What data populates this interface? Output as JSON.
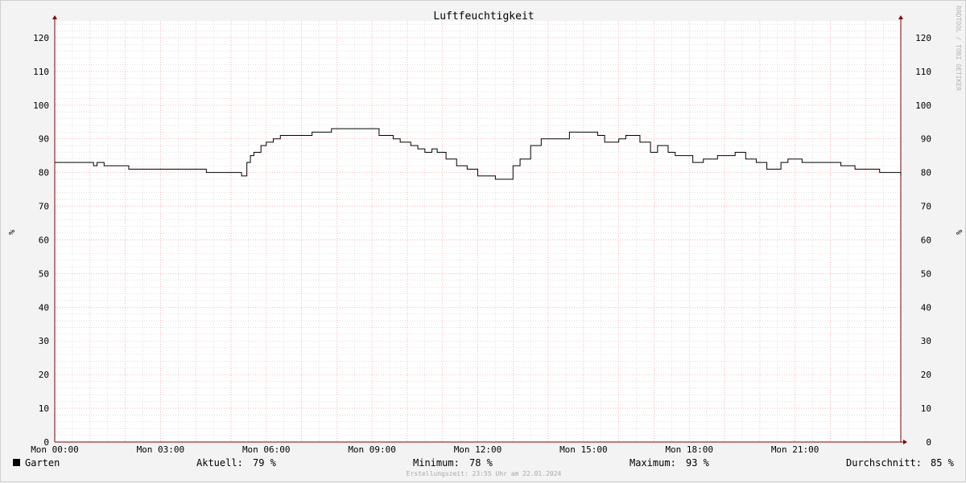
{
  "chart_data": {
    "type": "line",
    "title": "Luftfeuchtigkeit",
    "ylabel": "%",
    "ylim": [
      0,
      125
    ],
    "yticks": [
      0,
      10,
      20,
      30,
      40,
      50,
      60,
      70,
      80,
      90,
      100,
      110,
      120
    ],
    "xlim": [
      0,
      24
    ],
    "xticks": [
      {
        "value": 0,
        "label": "Mon 00:00"
      },
      {
        "value": 3,
        "label": "Mon 03:00"
      },
      {
        "value": 6,
        "label": "Mon 06:00"
      },
      {
        "value": 9,
        "label": "Mon 09:00"
      },
      {
        "value": 12,
        "label": "Mon 12:00"
      },
      {
        "value": 15,
        "label": "Mon 15:00"
      },
      {
        "value": 18,
        "label": "Mon 18:00"
      },
      {
        "value": 21,
        "label": "Mon 21:00"
      }
    ],
    "grid": true,
    "series": [
      {
        "name": "Garten",
        "color": "#000000",
        "x": [
          0,
          1.1,
          1.2,
          1.4,
          2.1,
          3.2,
          4.3,
          5.3,
          5.45,
          5.55,
          5.65,
          5.85,
          6.0,
          6.2,
          6.4,
          6.65,
          7.3,
          7.85,
          9.1,
          9.2,
          9.6,
          9.8,
          10.1,
          10.3,
          10.5,
          10.7,
          10.85,
          11.1,
          11.4,
          11.7,
          12.0,
          12.5,
          12.8,
          13.0,
          13.2,
          13.5,
          13.8,
          14.6,
          15.0,
          15.4,
          15.6,
          16.0,
          16.2,
          16.4,
          16.6,
          16.9,
          17.1,
          17.4,
          17.6,
          17.8,
          18.1,
          18.4,
          18.8,
          19.3,
          19.6,
          19.9,
          20.2,
          20.6,
          20.8,
          21.2,
          21.8,
          22.3,
          22.7,
          23.0,
          23.2,
          23.4,
          23.6,
          24.0
        ],
        "y": [
          83,
          82,
          83,
          82,
          81,
          81,
          80,
          79,
          83,
          85,
          86,
          88,
          89,
          90,
          91,
          91,
          92,
          93,
          93,
          91,
          90,
          89,
          88,
          87,
          86,
          87,
          86,
          84,
          82,
          81,
          79,
          78,
          78,
          82,
          84,
          88,
          90,
          92,
          92,
          91,
          89,
          90,
          91,
          91,
          89,
          86,
          88,
          86,
          85,
          85,
          83,
          84,
          85,
          86,
          84,
          83,
          81,
          83,
          84,
          83,
          83,
          82,
          81,
          81,
          81,
          80,
          80,
          79
        ]
      }
    ]
  },
  "legend": {
    "series_name": "Garten",
    "current_label": "Aktuell:",
    "current_value": "79 %",
    "minimum_label": "Minimum:",
    "minimum_value": "78 %",
    "maximum_label": "Maximum:",
    "maximum_value": "93 %",
    "average_label": "Durchschnitt:",
    "average_value": "85 %"
  },
  "footer": "Erstellungszeit: 23:55 Uhr am 22.01.2024",
  "watermark": "RRDTOOL / TOBI OETIKER",
  "colors": {
    "background": "#f3f3f3",
    "plot_background": "#ffffff",
    "major_grid": "#ff9999",
    "minor_grid": "#cccccc",
    "axis": "#800000",
    "line": "#000000"
  }
}
